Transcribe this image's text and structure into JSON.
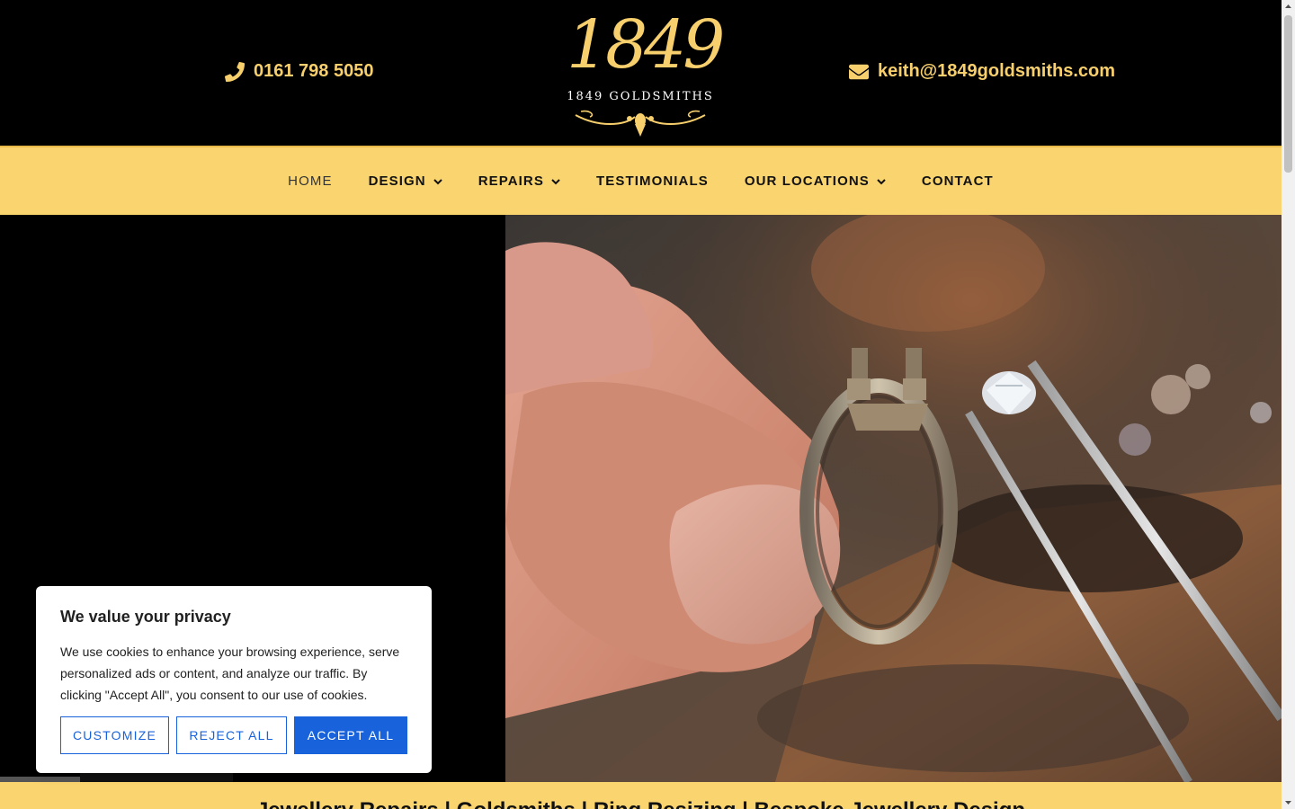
{
  "header": {
    "phone": "0161 798 5050",
    "email": "keith@1849goldsmiths.com",
    "logo_number": "1849",
    "logo_name": "1849 GOLDSMITHS",
    "phone_icon": "phone-icon",
    "email_icon": "envelope-icon"
  },
  "nav": {
    "items": [
      {
        "label": "HOME",
        "active": true,
        "dropdown": false
      },
      {
        "label": "DESIGN",
        "active": false,
        "dropdown": true
      },
      {
        "label": "REPAIRS",
        "active": false,
        "dropdown": true
      },
      {
        "label": "TESTIMONIALS",
        "active": false,
        "dropdown": false
      },
      {
        "label": "OUR LOCATIONS",
        "active": false,
        "dropdown": true
      },
      {
        "label": "CONTACT",
        "active": false,
        "dropdown": false
      }
    ]
  },
  "strip": {
    "text": "Jewellery Repairs | Goldsmiths | Ring Resizing | Bespoke Jewellery Design"
  },
  "cookie": {
    "title": "We value your privacy",
    "body": "We use cookies to enhance your browsing experience, serve personalized ads or content, and analyze our traffic. By clicking \"Accept All\", you consent to our use of cookies.",
    "customize": "CUSTOMIZE",
    "reject": "REJECT ALL",
    "accept": "ACCEPT ALL"
  },
  "colors": {
    "gold": "#f7cf6c",
    "nav_bg": "#fad46f",
    "accent_blue": "#1863dc",
    "black": "#000000"
  }
}
